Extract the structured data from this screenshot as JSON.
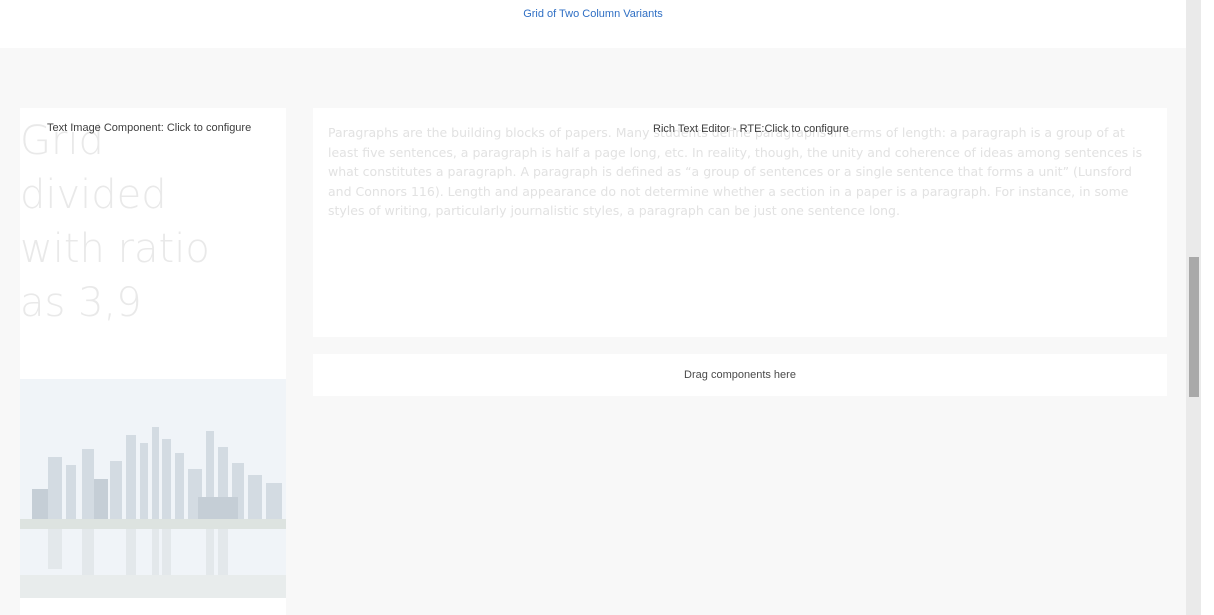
{
  "header": {
    "title": "Grid of Two Column Variants"
  },
  "left_column": {
    "component_label": "Text Image Component: Click to configure",
    "heading_lines": [
      "Grid",
      "divided",
      "with ratio",
      "as 3,9"
    ]
  },
  "rte": {
    "component_label": "Rich Text Editor - RTE:Click to configure",
    "body": "Paragraphs are the building blocks of papers. Many students define paragraphs in terms of length: a paragraph is a group of at least five sentences, a paragraph is half a page long, etc. In reality, though, the unity and coherence of ideas among sentences is what constitutes a paragraph. A paragraph is defined as “a group of sentences or a single sentence that forms a unit” (Lunsford and Connors 116). Length and appearance do not determine whether a section in a paper is a paragraph. For instance, in some styles of writing, particularly journalistic styles, a paragraph can be just one sentence long."
  },
  "drop_zone": {
    "label": "Drag components here"
  },
  "image": {
    "icon": "city-skyline-image"
  },
  "colors": {
    "title_link": "#2f6fc4",
    "faded_text": "#e2e2e2",
    "scrollbar_thumb": "#a9a9a9"
  }
}
